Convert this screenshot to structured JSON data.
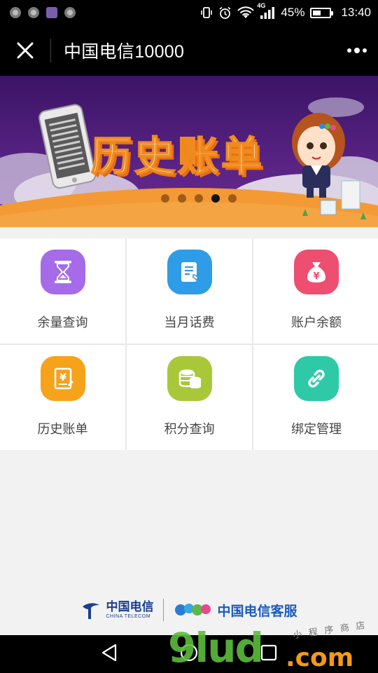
{
  "status_bar": {
    "network": "4G",
    "battery": "45%",
    "time": "13:40"
  },
  "header": {
    "title": "中国电信10000"
  },
  "banner": {
    "title": "历史账单",
    "active_slide": 4,
    "slide_count": 5
  },
  "menu": [
    {
      "label": "余量查询",
      "icon": "hourglass-icon",
      "color": "#a56be8"
    },
    {
      "label": "当月话费",
      "icon": "bill-phone-icon",
      "color": "#2e9ce6"
    },
    {
      "label": "账户余额",
      "icon": "money-bag-icon",
      "color": "#ee4e70"
    },
    {
      "label": "历史账单",
      "icon": "yuan-document-icon",
      "color": "#f7a21b"
    },
    {
      "label": "积分查询",
      "icon": "coins-icon",
      "color": "#a8c83a"
    },
    {
      "label": "绑定管理",
      "icon": "link-icon",
      "color": "#2ec9a6"
    }
  ],
  "footer": {
    "brand_cn": "中国电信",
    "brand_en": "CHINA TELECOM",
    "service_name": "中国电信客服"
  },
  "watermark": {
    "main": "9lud",
    "domain": ".com",
    "small": "小 程 序 商 店"
  }
}
